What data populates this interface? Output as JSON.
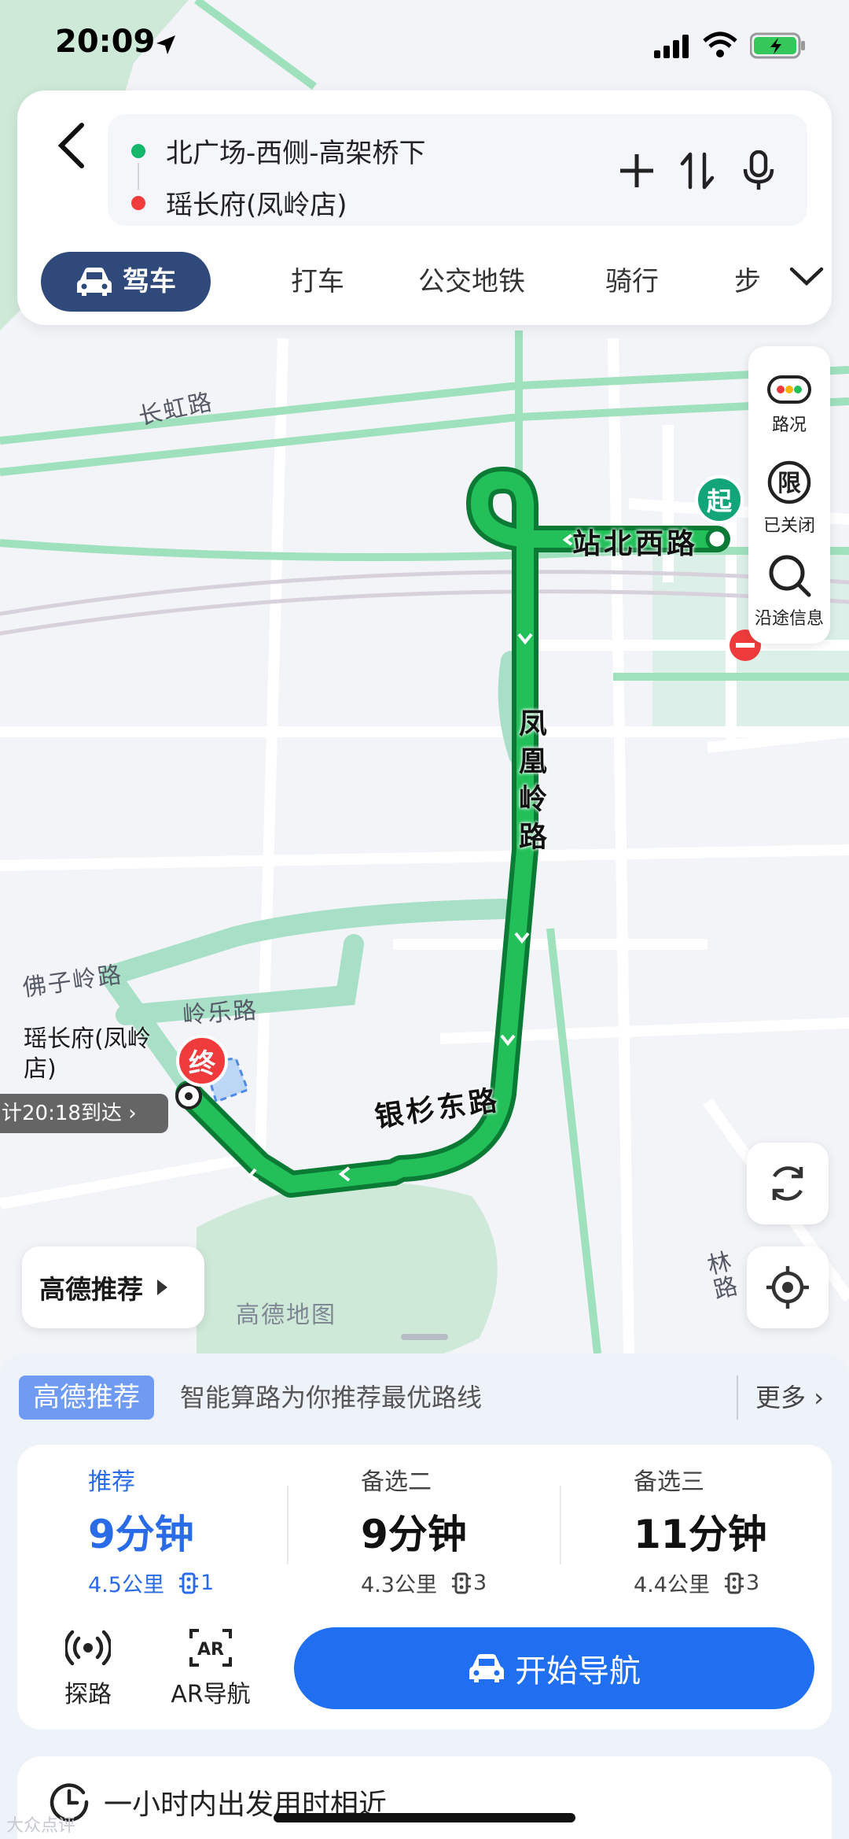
{
  "status_bar": {
    "time": "20:09"
  },
  "route": {
    "from": "北广场-西侧-高架桥下",
    "to": "瑶长府(凤岭店)"
  },
  "modes": [
    "驾车",
    "打车",
    "公交地铁",
    "骑行",
    "步"
  ],
  "tools": {
    "traffic": "路况",
    "restriction": "已关闭",
    "along_route": "沿途信息"
  },
  "map": {
    "roads": [
      "长虹路",
      "佛子岭路",
      "岭乐路",
      "银杉东路",
      "凤凰岭路",
      "站北西路",
      "林路"
    ],
    "destination_label": "瑶长府(凤岭店)",
    "eta": "计20:18到达",
    "start_marker": "起",
    "end_marker": "终",
    "watermark": "高德地图",
    "recommend_chip": "高德推荐"
  },
  "sheet": {
    "badge": "高德推荐",
    "tip": "智能算路为你推荐最优路线",
    "more": "更多",
    "options": [
      {
        "tag": "推荐",
        "duration": "9分钟",
        "distance": "4.5公里",
        "lights": "1",
        "selected": true
      },
      {
        "tag": "备选二",
        "duration": "9分钟",
        "distance": "4.3公里",
        "lights": "3",
        "selected": false
      },
      {
        "tag": "备选三",
        "duration": "11分钟",
        "distance": "4.4公里",
        "lights": "3",
        "selected": false
      }
    ],
    "explore": "探路",
    "ar_nav": "AR导航",
    "start_nav": "开始导航",
    "depart_hint": "一小时内出发用时相近"
  },
  "colors": {
    "route": "#19a94a",
    "accent": "#1f6ff0",
    "active_tab": "#2f4a7a",
    "end_pin": "#ef3b3b",
    "start_pin": "#12a57a"
  },
  "corner_watermark": "大众点评"
}
